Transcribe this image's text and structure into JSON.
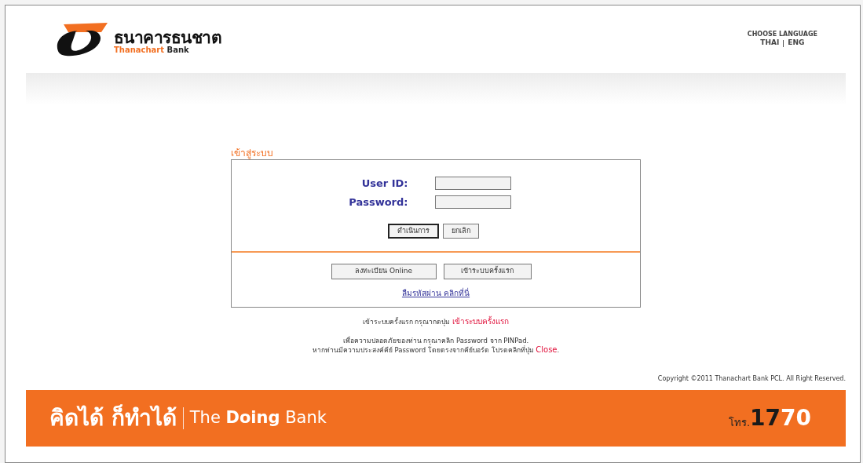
{
  "header": {
    "logo": {
      "thai_name": "ธนาคารธนชาต",
      "english_name": "Thanachart **Bank**"
    },
    "language": {
      "title": "CHOOSE LANGUAGE",
      "options": [
        {
          "label": "THAI"
        },
        {
          "label": "ENG"
        }
      ]
    }
  },
  "login": {
    "title": "เข้าสู่ระบบ",
    "fields": [
      {
        "label": "User ID:"
      },
      {
        "label": "Password:"
      }
    ],
    "buttons": [
      {
        "label": "ดำเนินการ",
        "selected": true
      },
      {
        "label": "ยกเลิก",
        "selected": false
      }
    ],
    "secondary_buttons": [
      {
        "label": "ลงทะเบียน Online"
      },
      {
        "label": "เข้าระบบครั้งแรก"
      }
    ],
    "forgot_link": "ลืมรหัสผ่าน คลิกที่นี่"
  },
  "notices": [
    {
      "text": "เข้าระบบครั้งแรก กรุณากดปุ่ม",
      "link": "เข้าระบบครั้งแรก"
    },
    {
      "text": "เพื่อความปลอดภัยของท่าน กรุณาคลิก Password จาก PINPad."
    },
    {
      "text": "หากท่านมีความประสงค์คีย์ Password โดยตรงจากคีย์บอร์ด โปรดคลิกที่ปุ่ม",
      "link": "Close",
      "after": "."
    }
  ],
  "copyright": "Copyright ©2011 Thanachart Bank PCL. All Right Reserved.",
  "footer": {
    "slogan_thai": "คิดได้ ก็ทำได้",
    "slogan_english": "The **Doing** Bank",
    "hotline_prefix": "โทร.",
    "hotline_dark": "17",
    "hotline_light": "70"
  }
}
